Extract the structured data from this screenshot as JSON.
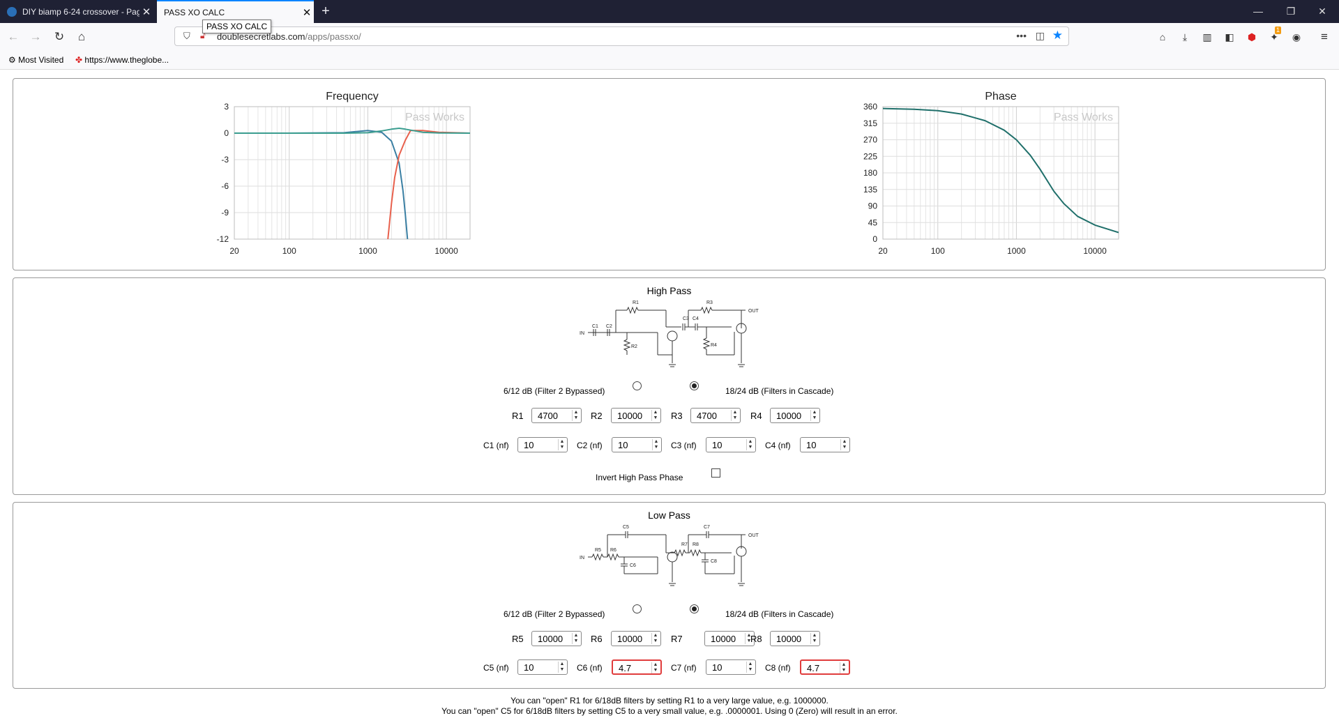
{
  "tabs": [
    {
      "title": "DIY biamp 6-24 crossover - Pag",
      "active": false
    },
    {
      "title": "PASS XO CALC",
      "active": true
    }
  ],
  "tooltip": "PASS XO CALC",
  "url": {
    "host": "doublesecretlabs.com",
    "path": "/apps/passxo/"
  },
  "bookmarks": [
    "Most Visited",
    "https://www.theglobe..."
  ],
  "toolbar_badge": "1",
  "charts": {
    "watermark": "Pass Works",
    "frequency": {
      "title": "Frequency",
      "y_ticks": [
        "3",
        "0",
        "-3",
        "-6",
        "-9",
        "-12"
      ],
      "x_ticks": [
        "20",
        "100",
        "1000",
        "10000"
      ]
    },
    "phase": {
      "title": "Phase",
      "y_ticks": [
        "360",
        "315",
        "270",
        "225",
        "180",
        "135",
        "90",
        "45",
        "0"
      ],
      "x_ticks": [
        "20",
        "100",
        "1000",
        "10000"
      ]
    }
  },
  "chart_data": [
    {
      "type": "line",
      "title": "Frequency",
      "x_scale": "log",
      "xlim": [
        20,
        20000
      ],
      "ylim": [
        -12,
        3
      ],
      "grid": true,
      "series": [
        {
          "color": "#3a7fa3",
          "x": [
            20,
            100,
            500,
            1000,
            1500,
            2000,
            2500,
            2800,
            3000,
            3200
          ],
          "y": [
            0,
            0,
            0.05,
            0.3,
            0.1,
            -0.9,
            -3.4,
            -6.5,
            -9.2,
            -12
          ]
        },
        {
          "color": "#e8604c",
          "x": [
            1800,
            2000,
            2200,
            2500,
            3000,
            3500,
            5000,
            8000,
            20000
          ],
          "y": [
            -12,
            -8,
            -5,
            -2.5,
            -0.8,
            0.3,
            0.3,
            0.1,
            0
          ]
        },
        {
          "color": "#3a9d8f",
          "x": [
            20,
            500,
            1000,
            1500,
            2000,
            2500,
            3000,
            4000,
            5000,
            8000,
            20000
          ],
          "y": [
            0,
            0,
            0.05,
            0.25,
            0.45,
            0.55,
            0.45,
            0.25,
            0.1,
            0.02,
            0
          ]
        }
      ]
    },
    {
      "type": "line",
      "title": "Phase",
      "x_scale": "log",
      "xlim": [
        20,
        20000
      ],
      "ylim": [
        0,
        360
      ],
      "grid": true,
      "series": [
        {
          "color": "#1f6f6a",
          "x": [
            20,
            50,
            100,
            200,
            400,
            700,
            1000,
            1500,
            2000,
            3000,
            4000,
            6000,
            10000,
            20000
          ],
          "y": [
            355,
            353,
            349,
            340,
            322,
            296,
            270,
            228,
            190,
            130,
            97,
            62,
            38,
            18
          ]
        }
      ]
    }
  ],
  "high_pass": {
    "title": "High Pass",
    "schematic_labels": [
      "R1",
      "R3",
      "OUT",
      "C3",
      "C4",
      "C1",
      "C2",
      "IN",
      "R2",
      "R4"
    ],
    "mode_a": "6/12 dB (Filter 2 Bypassed)",
    "mode_b": "18/24 dB (Filters in Cascade)",
    "selected": "mode_b",
    "resistors": [
      {
        "label": "R1",
        "value": "4700"
      },
      {
        "label": "R2",
        "value": "10000"
      },
      {
        "label": "R3",
        "value": "4700"
      },
      {
        "label": "R4",
        "value": "10000"
      }
    ],
    "caps": [
      {
        "label": "C1 (nf)",
        "value": "10"
      },
      {
        "label": "C2 (nf)",
        "value": "10"
      },
      {
        "label": "C3 (nf)",
        "value": "10"
      },
      {
        "label": "C4 (nf)",
        "value": "10"
      }
    ],
    "invert_label": "Invert High Pass Phase",
    "invert_checked": false
  },
  "low_pass": {
    "title": "Low Pass",
    "schematic_labels": [
      "C5",
      "C7",
      "OUT",
      "R7",
      "R8",
      "R5",
      "R6",
      "IN",
      "C6",
      "C8"
    ],
    "mode_a": "6/12 dB (Filter 2 Bypassed)",
    "mode_b": "18/24 dB (Filters in Cascade)",
    "selected": "mode_b",
    "resistors": [
      {
        "label": "R5",
        "value": "10000"
      },
      {
        "label": "R6",
        "value": "10000"
      },
      {
        "label": "R7",
        "value": "10000"
      },
      {
        "label": "R8",
        "value": "10000"
      }
    ],
    "caps": [
      {
        "label": "C5 (nf)",
        "value": "10",
        "error": false
      },
      {
        "label": "C6 (nf)",
        "value": "4.7",
        "error": true
      },
      {
        "label": "C7 (nf)",
        "value": "10",
        "error": false
      },
      {
        "label": "C8 (nf)",
        "value": "4.7",
        "error": true
      }
    ]
  },
  "notes": [
    "You can \"open\" R1 for 6/18dB filters by setting R1 to a very large value, e.g. 1000000.",
    "You can \"open\" C5 for 6/18dB filters by setting C5 to a very small value, e.g. .0000001. Using 0 (Zero) will result in an error."
  ]
}
